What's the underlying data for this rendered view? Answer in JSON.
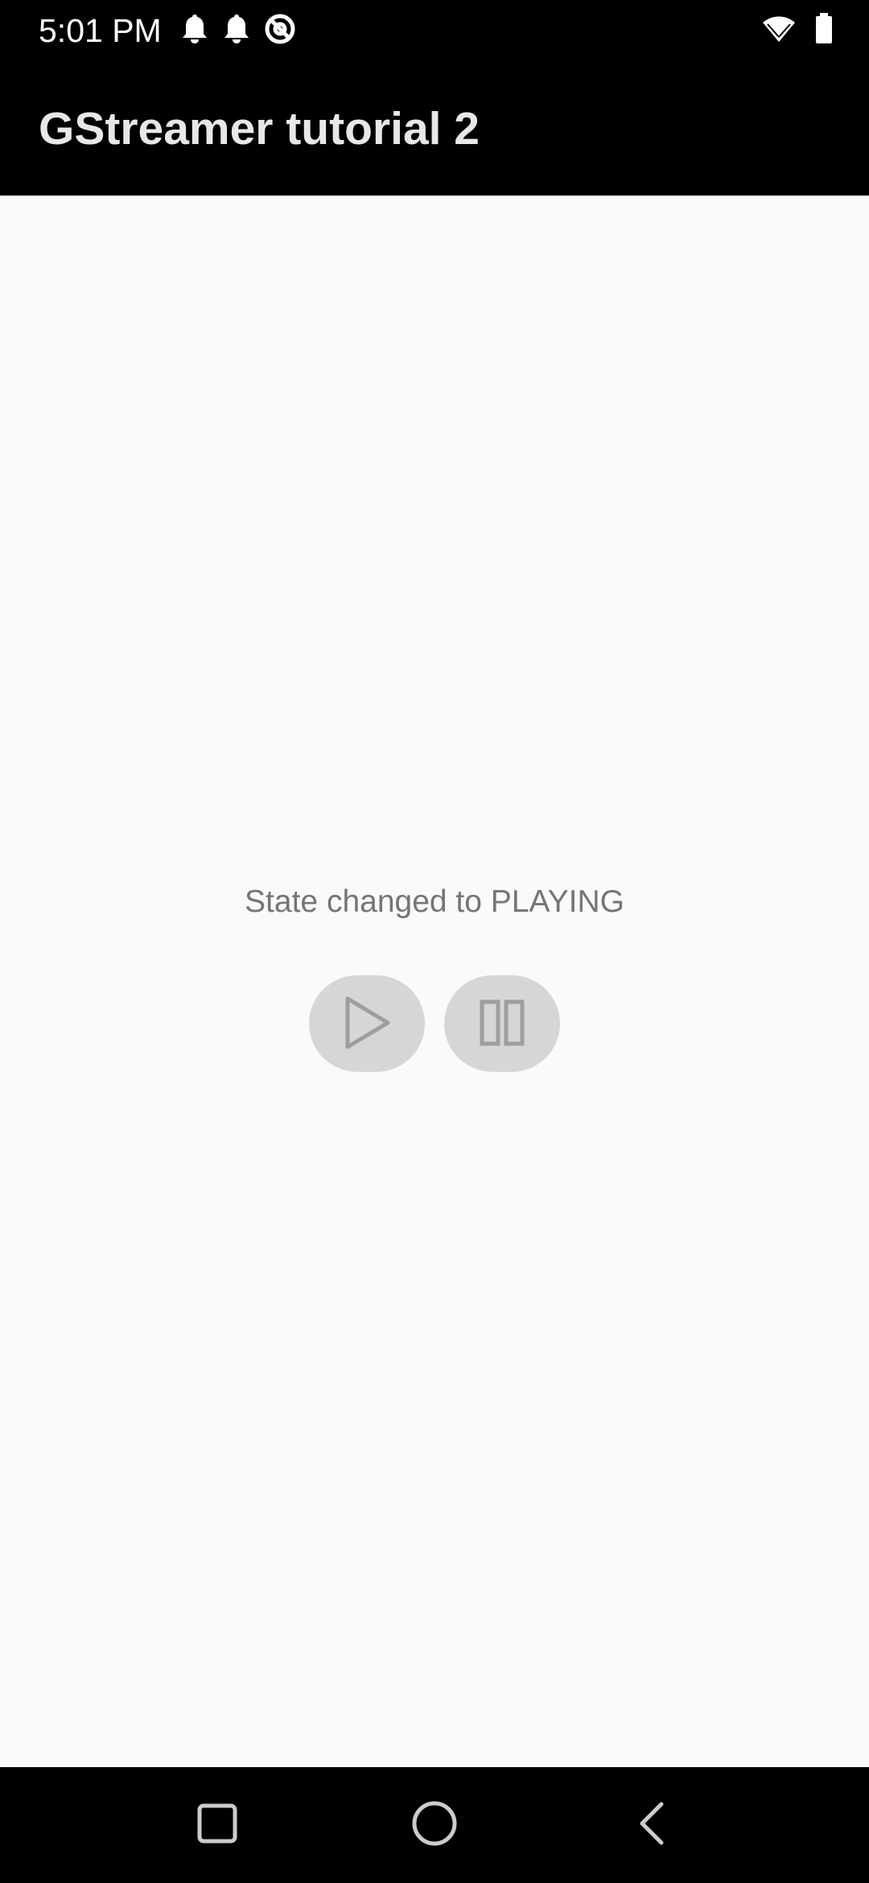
{
  "status_bar": {
    "time": "5:01 PM",
    "left_icons": [
      "notification-bell-icon",
      "notification-bell-icon",
      "at-sign-icon"
    ],
    "right_icons": [
      "wifi-icon",
      "battery-icon"
    ]
  },
  "app_bar": {
    "title": "GStreamer tutorial 2"
  },
  "main": {
    "state_message": "State changed to PLAYING",
    "play_button_icon": "play-icon",
    "pause_button_icon": "pause-icon"
  },
  "navigation_bar": {
    "buttons": [
      "recents-square-icon",
      "home-circle-icon",
      "back-triangle-icon"
    ]
  },
  "colors": {
    "bars_background": "#000000",
    "content_background": "#fafafa",
    "button_background": "#d6d6d6",
    "icon_gray": "#9e9e9e",
    "state_text": "#757575"
  }
}
